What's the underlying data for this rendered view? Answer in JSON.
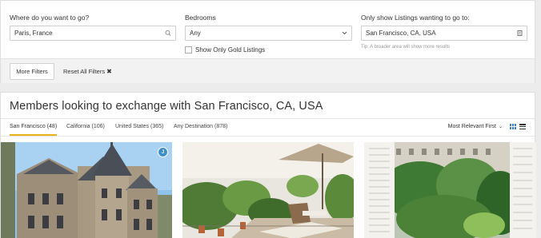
{
  "filters": {
    "destination": {
      "label": "Where do you want to go?",
      "value": "Paris, France"
    },
    "bedrooms": {
      "label": "Bedrooms",
      "value": "Any"
    },
    "gold_only": {
      "label": "Show Only Gold Listings",
      "checked": false
    },
    "wanting_to_go": {
      "label": "Only show Listings wanting to go to:",
      "value": "San Francisco, CA, USA",
      "tip": "Tip: A broader area will show more results"
    },
    "more_filters_label": "More Filters",
    "reset_label": "Reset All Filters"
  },
  "results": {
    "title": "Members looking to exchange with San Francisco, CA, USA",
    "tabs": [
      {
        "label": "San Francisco",
        "count": "(48)",
        "active": true
      },
      {
        "label": "California",
        "count": "(106)",
        "active": false
      },
      {
        "label": "United States",
        "count": "(365)",
        "active": false
      },
      {
        "label": "Any Destination",
        "count": "(878)",
        "active": false
      }
    ],
    "sort_label": "Most Relevant First",
    "cards": [
      {
        "kind": "chateau",
        "badge": "J"
      },
      {
        "kind": "terrace"
      },
      {
        "kind": "window-view"
      }
    ]
  },
  "colors": {
    "accent_underline": "#e9b317",
    "badge_blue": "#3e8fc9",
    "grid_icon_blue": "#3b7fcc"
  }
}
